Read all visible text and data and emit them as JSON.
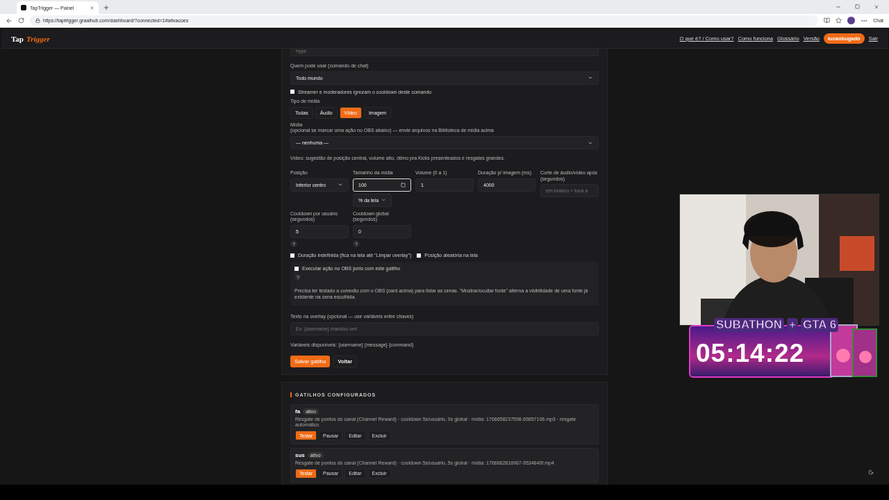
{
  "browser": {
    "tab_title": "TapTrigger — Painel",
    "url": "https://taptrigger.graalhub.com/dashboard/?connected=1#ativacoes",
    "profile_label": "Chat"
  },
  "header": {
    "logo_first": "Tap",
    "logo_second": "Trigger",
    "links": [
      "O que é? / Como usar?",
      "Como funciona",
      "Glossário",
      "Versão"
    ],
    "user_button": "lucaobugado",
    "logout": "Sair"
  },
  "form": {
    "top_field": {
      "placeholder": "hype"
    },
    "who_label": "Quem pode usar (comando de chat)",
    "who_value": "Todo mundo",
    "ignore_cooldown": {
      "label": "Streamer e moderadores ignoram o cooldown deste comando",
      "checked": false
    },
    "media_type_label": "Tipo de mídia",
    "media_types": [
      {
        "label": "Todas",
        "selected": false
      },
      {
        "label": "Áudio",
        "selected": false
      },
      {
        "label": "Vídeo",
        "selected": true
      },
      {
        "label": "Imagem",
        "selected": false
      }
    ],
    "media_label": "Mídia",
    "media_hint": "(opcional se marcar uma ação no OBS abaixo) — envie arquivos na Biblioteca de mídia acima",
    "media_value": "— nenhuma —",
    "suggestion": "Vídeo: sugestão de posição central, volume alto, ótimo pra Kicks presenteados e resgates grandes.",
    "position": {
      "label": "Posição",
      "value": "Inferior centro"
    },
    "size": {
      "label": "Tamanho da mídia",
      "value": "100",
      "unit": "% da tela"
    },
    "volume": {
      "label": "Volume (0 a 1)",
      "value": "1"
    },
    "duration": {
      "label": "Duração p/ imagem (ms)",
      "value": "4000"
    },
    "cut": {
      "label": "Corte de áudio/vídeo após (segundos)",
      "placeholder": "em branco = toca a"
    },
    "user_cooldown": {
      "label": "Cooldown por usuário (segundos)",
      "value": "5",
      "help": "?"
    },
    "global_cooldown": {
      "label": "Cooldown global (segundos)",
      "value": "0",
      "help": "?"
    },
    "indefinite": {
      "label": "Duração indefinida (fica na tela até \"Limpar overlay\")",
      "checked": false
    },
    "random_position": {
      "label": "Posição aleatória na tela",
      "checked": false
    },
    "obs": {
      "label": "Executar ação no OBS junto com este gatilho",
      "checked": false,
      "help": "?",
      "note": "Precisa ter testado a conexão com o OBS (card acima) para listar as cenas. \"Mostrar/ocultar fonte\" alterna a visibilidade de uma fonte já existente na cena escolhida."
    },
    "overlay_text_label": "Texto na overlay (opcional — use variáveis entre chaves)",
    "overlay_text_placeholder": "Ex: {username} mandou ver!",
    "variables": "Variáveis disponíveis: {username} {message} {command}",
    "save": "Salvar gatilho",
    "back": "Voltar"
  },
  "triggers": {
    "title": "GATILHOS CONFIGURADOS",
    "items": [
      {
        "name": "fa",
        "status": "ativo",
        "details": "Resgate de pontos do canal (Channel Reward) · cooldown 5s/usuário, 0s global · mídia: 1766658237598-65857106.mp3 · resgate automático",
        "actions": [
          "Testar",
          "Pausar",
          "Editar",
          "Excluir"
        ]
      },
      {
        "name": "sus",
        "status": "ativo",
        "details": "Resgate de pontos do canal (Channel Reward) · cooldown 5s/usuário, 5s global · mídia: 1766662816967-9534640f.mp4",
        "actions": [
          "Testar",
          "Pausar",
          "Editar",
          "Excluir"
        ]
      }
    ]
  },
  "stream_overlay": {
    "title_left": "SUBATHON",
    "plus": "+",
    "title_right": "GTA 6",
    "timer": "05:14:22"
  }
}
